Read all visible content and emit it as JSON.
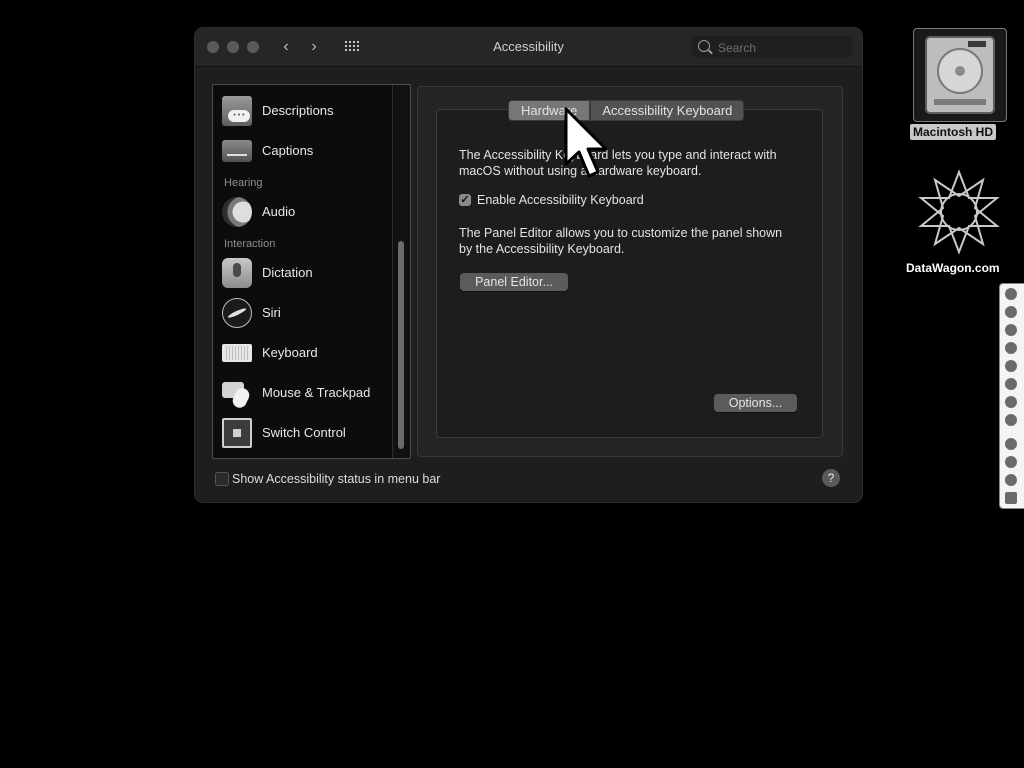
{
  "window": {
    "title": "Accessibility",
    "search_placeholder": "Search"
  },
  "sidebar": {
    "items": [
      {
        "label": "Descriptions",
        "icon": "descriptions-icon"
      },
      {
        "label": "Captions",
        "icon": "captions-icon"
      },
      {
        "label": "Audio",
        "icon": "audio-icon"
      },
      {
        "label": "Dictation",
        "icon": "dictation-icon"
      },
      {
        "label": "Siri",
        "icon": "siri-icon"
      },
      {
        "label": "Keyboard",
        "icon": "keyboard-icon",
        "selected": true
      },
      {
        "label": "Mouse & Trackpad",
        "icon": "mouse-trackpad-icon"
      },
      {
        "label": "Switch Control",
        "icon": "switch-control-icon"
      }
    ],
    "headers": {
      "hearing": "Hearing",
      "interaction": "Interaction"
    }
  },
  "tabs": [
    {
      "label": "Hardware",
      "selected": true
    },
    {
      "label": "Accessibility Keyboard",
      "selected": false
    }
  ],
  "content": {
    "description1": "The Accessibility Keyboard lets you type and interact with macOS without using a hardware keyboard.",
    "checkbox_label": "Enable Accessibility Keyboard",
    "checkbox_checked": true,
    "checkbox_mark": "✓",
    "description2": "The Panel Editor allows you to customize the panel shown by the Accessibility Keyboard.",
    "panel_editor_button": "Panel Editor...",
    "options_button": "Options..."
  },
  "footer": {
    "status_label": "Show Accessibility status in menu bar",
    "status_checked": false,
    "help_label": "?"
  },
  "desktop": {
    "hd_label": "Macintosh HD",
    "datawagon_label": "DataWagon.com"
  },
  "colors": {
    "window_bg": "#1e1e1e",
    "sidebar_bg": "#0c0c0c",
    "selected_tab": "#767676",
    "button": "#5b5b5b"
  }
}
